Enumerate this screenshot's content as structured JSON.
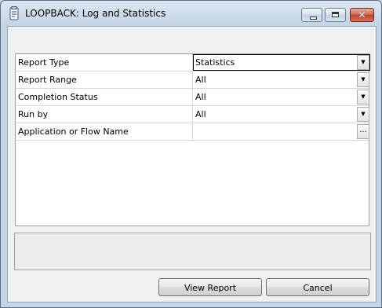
{
  "window": {
    "title": "LOOPBACK: Log and Statistics",
    "minimize_glyph": "",
    "maximize_glyph": "",
    "close_glyph": "✕"
  },
  "properties": [
    {
      "label": "Report Type",
      "value": "Statistics",
      "control": "dropdown"
    },
    {
      "label": "Report Range",
      "value": "All",
      "control": "dropdown"
    },
    {
      "label": "Completion Status",
      "value": "All",
      "control": "dropdown"
    },
    {
      "label": "Run by",
      "value": "All",
      "control": "dropdown"
    },
    {
      "label": "Application or Flow Name",
      "value": "",
      "control": "browse"
    }
  ],
  "controls": {
    "dropdown_glyph": "▼",
    "browse_glyph": "..."
  },
  "status_text": "",
  "buttons": {
    "view_report": "View Report",
    "cancel": "Cancel"
  }
}
